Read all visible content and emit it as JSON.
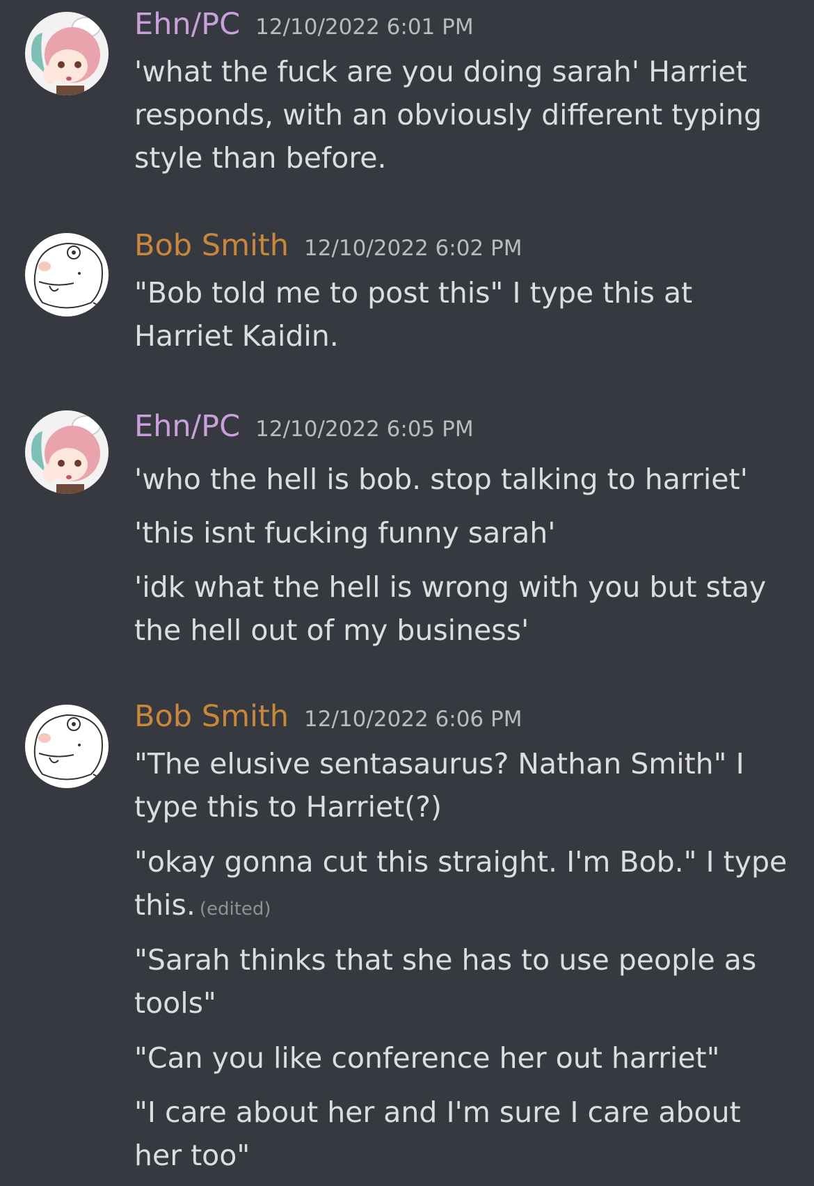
{
  "colors": {
    "background": "#36393f",
    "ehn_name": "#c9a0dc",
    "bob_name": "#c8873a",
    "text": "#dcddde",
    "timestamp": "#b9bbbe"
  },
  "messages": [
    {
      "author": "Ehn/PC",
      "timestamp": "12/10/2022 6:01 PM",
      "avatar": "anime-girl-avatar",
      "lines": [
        "'what the fuck are you doing sarah' Harriet responds, with an obviously different typing style than before."
      ]
    },
    {
      "author": "Bob Smith",
      "timestamp": "12/10/2022 6:02 PM",
      "avatar": "doodle-face-avatar",
      "lines": [
        "\"Bob told me to post this\" I type this at Harriet Kaidin."
      ]
    },
    {
      "author": "Ehn/PC",
      "timestamp": "12/10/2022 6:05 PM",
      "avatar": "anime-girl-avatar",
      "lines": [
        "'who the hell is bob. stop talking to harriet'",
        "'this isnt fucking funny sarah'",
        "'idk what the hell is wrong with you but stay the hell out of my business'"
      ]
    },
    {
      "author": "Bob Smith",
      "timestamp": "12/10/2022 6:06 PM",
      "avatar": "doodle-face-avatar",
      "lines": [
        "\"The elusive sentasaurus? Nathan Smith\" I type this to Harriet(?)",
        "\"okay gonna cut this straight. I'm Bob.\" I type this.",
        "\"Sarah thinks that she has to use people as tools\"",
        "\"Can you like conference her out harriet\"",
        "\"I care about her and I'm sure I care about her too\""
      ],
      "edited_label": "(edited)"
    }
  ]
}
